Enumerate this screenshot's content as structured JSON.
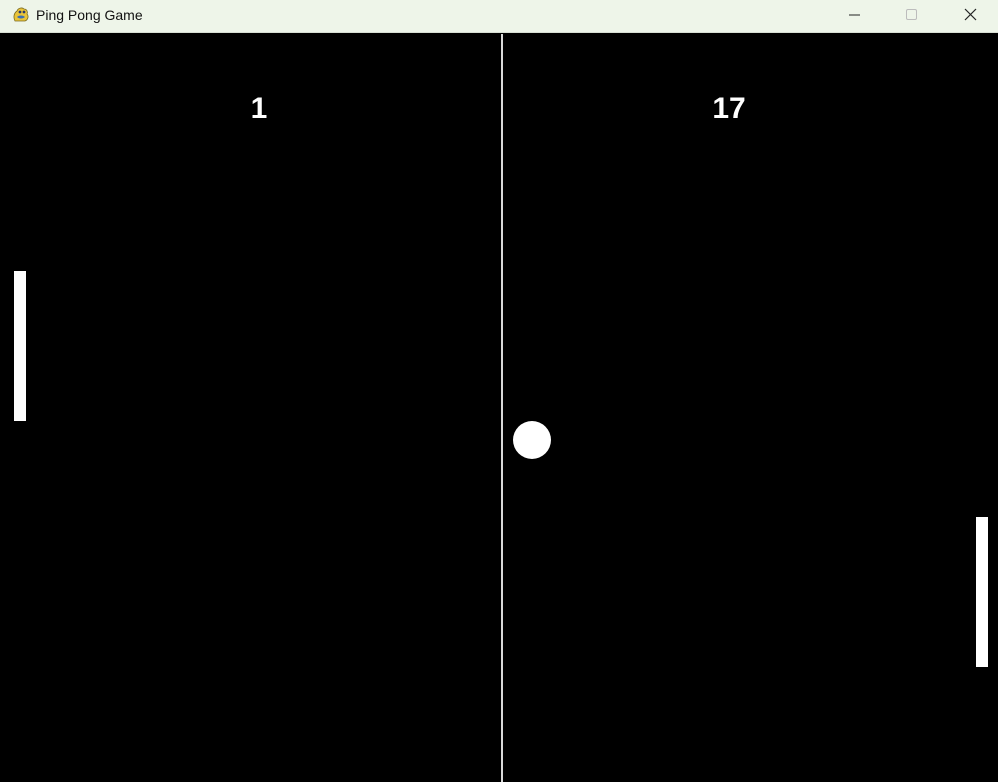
{
  "window": {
    "title": "Ping Pong Game",
    "icon": "pygame-snake-icon",
    "controls": [
      "minimize-icon",
      "maximize-icon",
      "close-icon"
    ]
  },
  "game": {
    "score_left": "1",
    "score_right": "17",
    "colors": {
      "background": "#000000",
      "foreground": "#ffffff",
      "net": "#d9d9d9",
      "titlebar": "#eef5e9"
    }
  }
}
